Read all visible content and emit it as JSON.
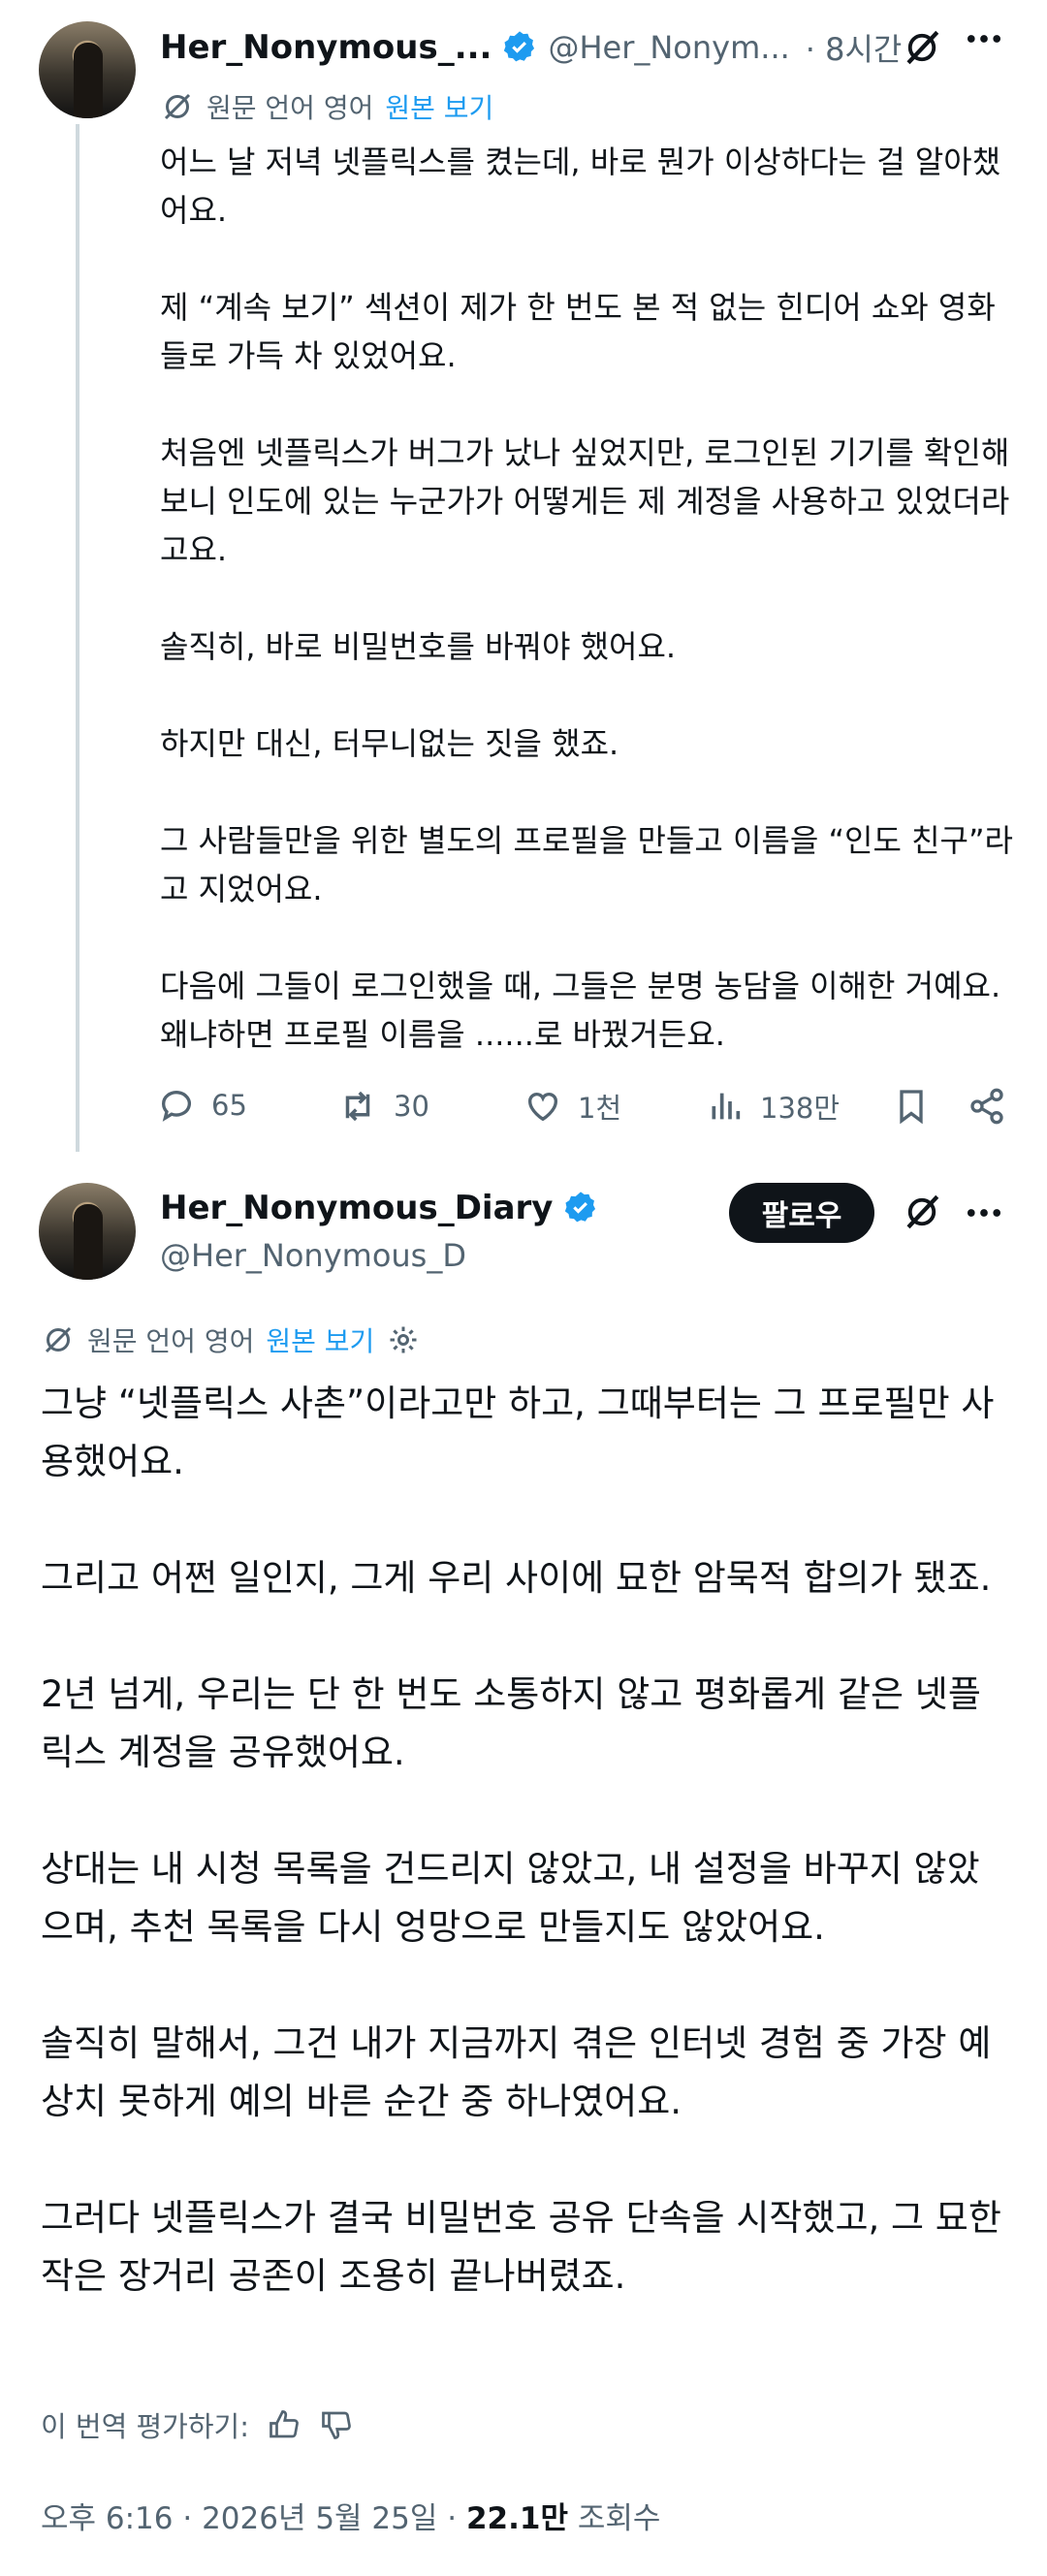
{
  "tweet1": {
    "display_name": "Her_Nonymous_...",
    "handle": "@Her_Nonym...",
    "time": "· 8시간",
    "translation": {
      "text": "원문 언어 영어",
      "link": "원본 보기"
    },
    "paragraphs": [
      "어느 날 저녁 넷플릭스를 켰는데, 바로 뭔가 이상하다는 걸 알아챘어요.",
      "제 “계속 보기” 섹션이 제가 한 번도 본 적 없는 힌디어 쇼와 영화들로 가득 차 있었어요.",
      "처음엔 넷플릭스가 버그가 났나 싶었지만, 로그인된 기기를 확인해보니 인도에 있는 누군가가 어떻게든 제 계정을 사용하고 있었더라고요.",
      "솔직히, 바로 비밀번호를 바꿔야 했어요.",
      "하지만 대신, 터무니없는 짓을 했죠.",
      "그 사람들만을 위한 별도의 프로필을 만들고 이름을 “인도 친구”라고 지었어요.",
      "다음에 그들이 로그인했을 때, 그들은 분명 농담을 이해한 거예요. 왜냐하면 프로필 이름을 ......로 바꿨거든요."
    ],
    "actions": {
      "replies": "65",
      "reposts": "30",
      "likes": "1천",
      "views": "138만"
    }
  },
  "tweet2": {
    "display_name": "Her_Nonymous_Diary",
    "handle": "@Her_Nonymous_D",
    "follow_label": "팔로우",
    "translation": {
      "text": "원문 언어 영어",
      "link": "원본 보기"
    },
    "paragraphs": [
      "그냥 “넷플릭스 사촌”이라고만 하고, 그때부터는 그 프로필만 사용했어요.",
      "그리고 어쩐 일인지, 그게 우리 사이에 묘한 암묵적 합의가 됐죠.",
      "2년 넘게, 우리는 단 한 번도 소통하지 않고 평화롭게 같은 넷플릭스 계정을 공유했어요.",
      "상대는 내 시청 목록을 건드리지 않았고, 내 설정을 바꾸지 않았으며, 추천 목록을 다시 엉망으로 만들지도 않았어요.",
      "솔직히 말해서, 그건 내가 지금까지 겪은 인터넷 경험 중 가장 예상치 못하게 예의 바른 순간 중 하나였어요.",
      "그러다 넷플릭스가 결국 비밀번호 공유 단속을 시작했고, 그 묘한 작은 장거리 공존이 조용히 끝나버렸죠."
    ],
    "rate_label": "이 번역 평가하기:",
    "meta": {
      "datetime": "오후 6:16 · 2026년 5월 25일 ·",
      "views_count": "22.1만",
      "views_label": "조회수"
    }
  },
  "colors": {
    "accent": "#1d9bf0",
    "text": "#0f1419",
    "muted": "#536471"
  },
  "icons": [
    "grok-icon",
    "more-icon",
    "translate-icon",
    "reply-icon",
    "repost-icon",
    "like-icon",
    "views-icon",
    "bookmark-icon",
    "share-icon",
    "settings-icon",
    "thumbs-up-icon",
    "thumbs-down-icon",
    "verified-badge-icon"
  ]
}
